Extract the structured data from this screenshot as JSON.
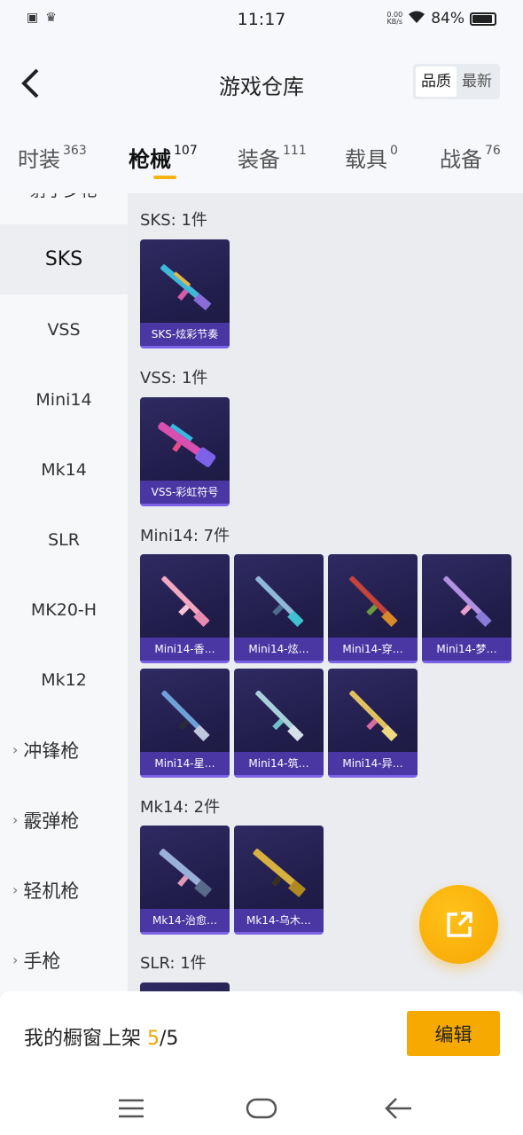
{
  "status_bar": {
    "time": "11:17",
    "speed_value": "0.00",
    "speed_unit": "KB/s",
    "battery": "84%",
    "battery_level": 0.84
  },
  "header": {
    "title": "游戏仓库",
    "sort_quality": "品质",
    "sort_newest": "最新"
  },
  "tabs": [
    {
      "label": "时装",
      "count": "363"
    },
    {
      "label": "枪械",
      "count": "107"
    },
    {
      "label": "装备",
      "count": "111"
    },
    {
      "label": "载具",
      "count": "0"
    },
    {
      "label": "战备",
      "count": "76"
    }
  ],
  "sidebar": {
    "items": [
      "射手步枪",
      "SKS",
      "VSS",
      "Mini14",
      "Mk14",
      "SLR",
      "MK20-H",
      "Mk12",
      "冲锋枪",
      "霰弹枪",
      "轻机枪",
      "手枪"
    ]
  },
  "sections": [
    {
      "title": "SKS: 1件",
      "items": [
        "SKS-炫彩节奏"
      ]
    },
    {
      "title": "VSS: 1件",
      "items": [
        "VSS-彩虹符号"
      ]
    },
    {
      "title": "Mini14: 7件",
      "items": [
        "Mini14-香…",
        "Mini14-炫…",
        "Mini14-穿…",
        "Mini14-梦…",
        "Mini14-星…",
        "Mini14-筑…",
        "Mini14-异…"
      ]
    },
    {
      "title": "Mk14: 2件",
      "items": [
        "Mk14-治愈…",
        "Mk14-乌木…"
      ]
    },
    {
      "title": "SLR: 1件",
      "items": []
    }
  ],
  "bottom": {
    "showcase_label": "我的橱窗上架",
    "showcase_current": "5",
    "showcase_total": "/5",
    "edit_label": "编辑"
  },
  "colors": {
    "accent": "#f6a900",
    "card_bg": "#221e4c",
    "card_label": "#4a37a4"
  }
}
